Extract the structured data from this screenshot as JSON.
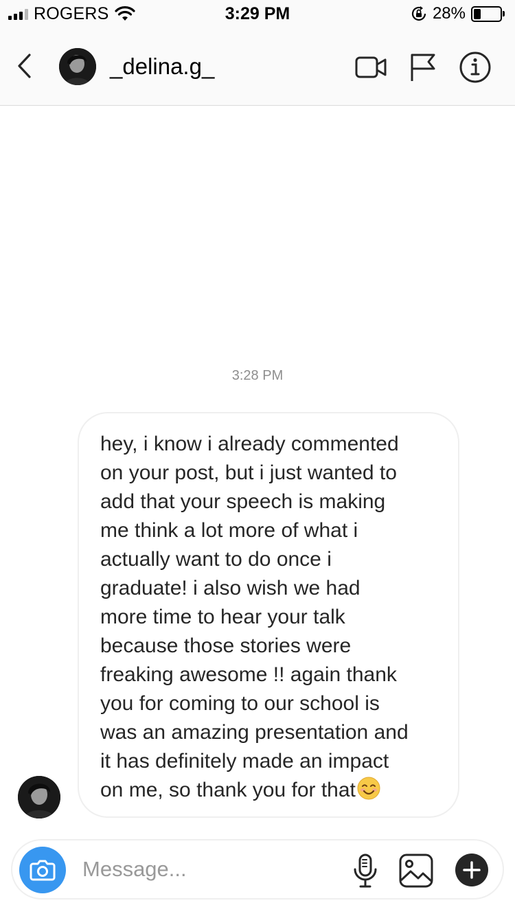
{
  "status_bar": {
    "carrier": "ROGERS",
    "time": "3:29 PM",
    "battery_percent": "28%",
    "battery_level": 0.28,
    "icons": [
      "signal-icon",
      "wifi-icon",
      "orientation-lock-icon",
      "battery-icon"
    ]
  },
  "header": {
    "username": "_delina.g_",
    "icons": [
      "back-chevron-icon",
      "avatar",
      "video-call-icon",
      "flag-icon",
      "info-icon"
    ]
  },
  "conversation": {
    "timestamp": "3:28 PM",
    "message": {
      "text": "hey, i know i already commented\non your post, but i just wanted to\nadd that your speech is making\nme think a lot more of what i\nactually want to do once i\ngraduate! i also wish we had\nmore time to hear your talk\nbecause those stories were\nfreaking awesome !! again thank\nyou for coming to our school is\nwas an amazing presentation and\nit has definitely made an impact\non me, so thank you for that",
      "trailing_emoji": "smiling-face-icon"
    }
  },
  "composer": {
    "placeholder": "Message...",
    "icons": [
      "camera-icon",
      "microphone-icon",
      "gallery-icon",
      "plus-icon"
    ],
    "accent_color": "#3897f0"
  }
}
